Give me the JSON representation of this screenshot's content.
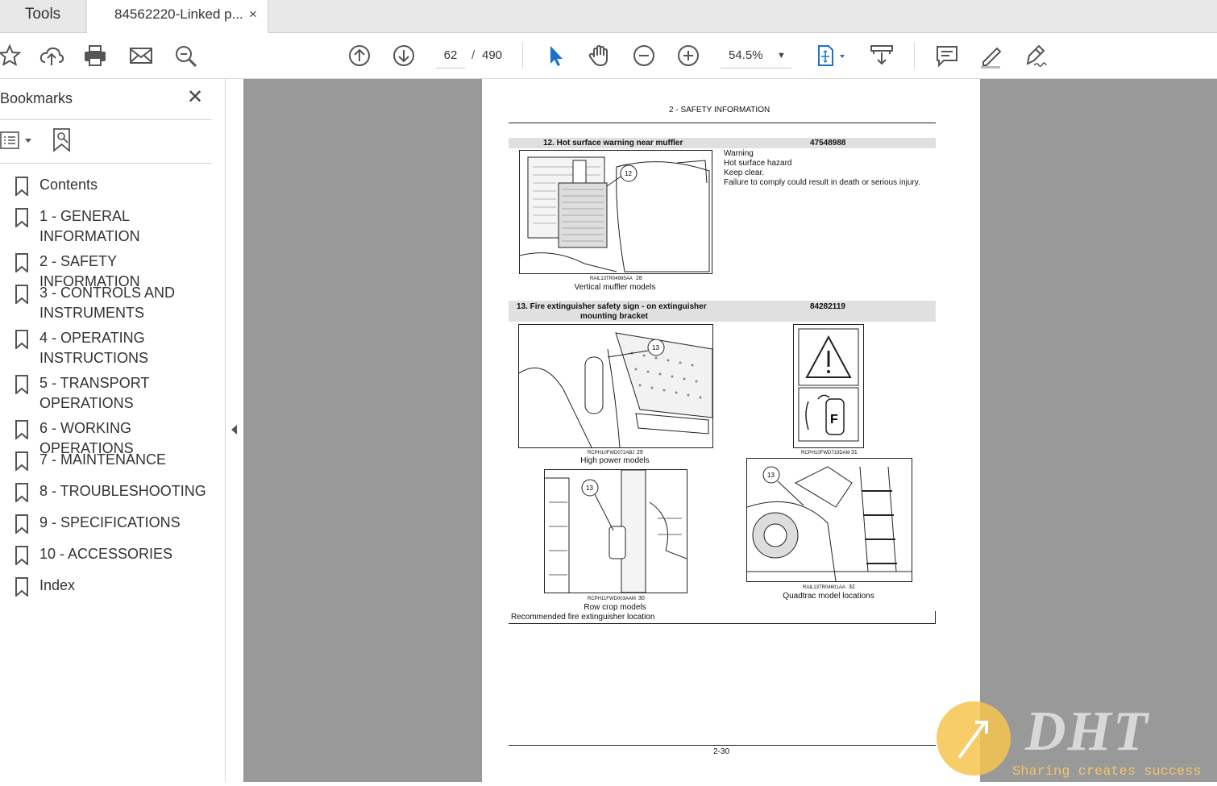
{
  "tabs": {
    "tools": "Tools",
    "document": "84562220-Linked p...",
    "close": "×"
  },
  "toolbar": {
    "page_current": "62",
    "page_sep": "/",
    "page_total": "490",
    "zoom": "54.5%",
    "zoom_caret": "▼"
  },
  "sidebar": {
    "title": "Bookmarks",
    "close": "✕",
    "items": [
      {
        "label": "Contents"
      },
      {
        "label": "1 - GENERAL\nINFORMATION"
      },
      {
        "label": "2 - SAFETY INFORMATION"
      },
      {
        "label": "3 - CONTROLS AND\nINSTRUMENTS"
      },
      {
        "label": "4 - OPERATING\nINSTRUCTIONS"
      },
      {
        "label": "5 - TRANSPORT\nOPERATIONS"
      },
      {
        "label": "6 - WORKING OPERATIONS"
      },
      {
        "label": "7 - MAINTENANCE"
      },
      {
        "label": "8 - TROUBLESHOOTING"
      },
      {
        "label": "9 - SPECIFICATIONS"
      },
      {
        "label": "10 - ACCESSORIES"
      },
      {
        "label": "Index"
      }
    ]
  },
  "page": {
    "header": "2 - SAFETY INFORMATION",
    "section12": {
      "title": "12. Hot surface warning near muffler",
      "part": "47548988",
      "warning_lines": [
        "Warning",
        "Hot surface hazard",
        "Keep clear.",
        "Failure to comply could result in death or serious injury."
      ],
      "img_code": "RAIL13TR04985AA",
      "img_num": "28",
      "caption": "Vertical muffler models",
      "callout": "12"
    },
    "section13": {
      "title_line1": "13. Fire extinguisher safety sign - on extinguisher",
      "title_line2": "mounting bracket",
      "part": "84282119",
      "callout": "13",
      "fig29": {
        "code": "RCPH10FWD072ABJ",
        "num": "29",
        "caption": "High power models"
      },
      "fig31": {
        "code": "RCPH10FWD719DAM",
        "num": "31"
      },
      "fig30": {
        "code": "RCPH11FWD003AAM",
        "num": "30",
        "caption": "Row crop models"
      },
      "fig32": {
        "code": "RAIL13TR04601AA",
        "num": "32",
        "caption": "Quadtrac model locations"
      },
      "footer_note": "Recommended fire extinguisher location"
    },
    "page_number": "2-30"
  },
  "watermark": {
    "brand": "DHT",
    "tagline": "Sharing creates success"
  }
}
